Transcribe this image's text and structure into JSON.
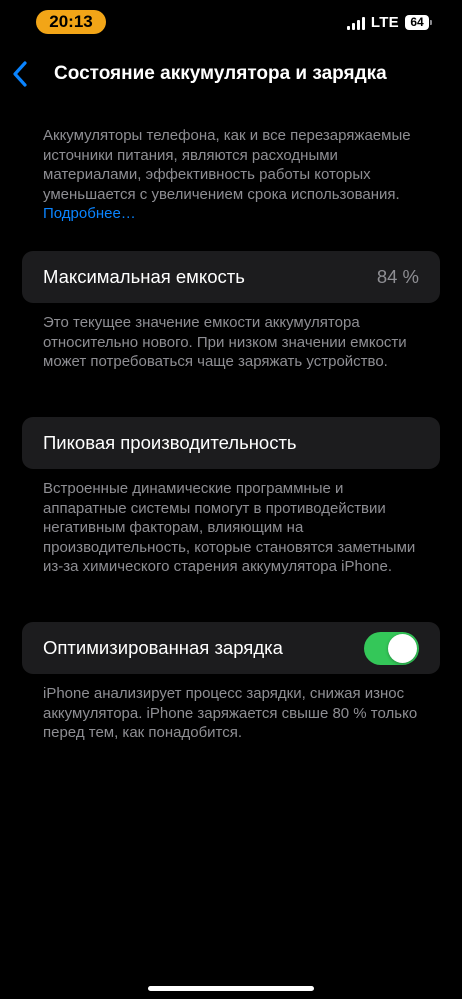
{
  "status_bar": {
    "time": "20:13",
    "network": "LTE",
    "battery_level": "64"
  },
  "nav": {
    "title": "Состояние аккумулятора и зарядка"
  },
  "intro": {
    "text": "Аккумуляторы телефона, как и все перезаряжаемые источники питания, являются расходными материалами, эффективность работы которых уменьшается с увеличением срока использования. ",
    "link": "Подробнее…"
  },
  "max_capacity": {
    "label": "Максимальная емкость",
    "value": "84 %",
    "footer": "Это текущее значение емкости аккумулятора относительно нового. При низком значении емкости может потребоваться чаще заряжать устройство."
  },
  "peak_performance": {
    "label": "Пиковая производительность",
    "footer": "Встроенные динамические программные и аппаратные системы помогут в противодействии негативным факторам, влияющим на производительность, которые становятся заметными из-за химического старения аккумулятора iPhone."
  },
  "optimized_charging": {
    "label": "Оптимизированная зарядка",
    "enabled": true,
    "footer": "iPhone анализирует процесс зарядки, снижая износ аккумулятора. iPhone заряжается свыше 80 % только перед тем, как понадобится."
  },
  "colors": {
    "background": "#000000",
    "card": "#1c1c1e",
    "secondary_text": "#8e8e93",
    "link": "#0a84ff",
    "toggle_on": "#34c759",
    "time_pill": "#f2a517"
  }
}
